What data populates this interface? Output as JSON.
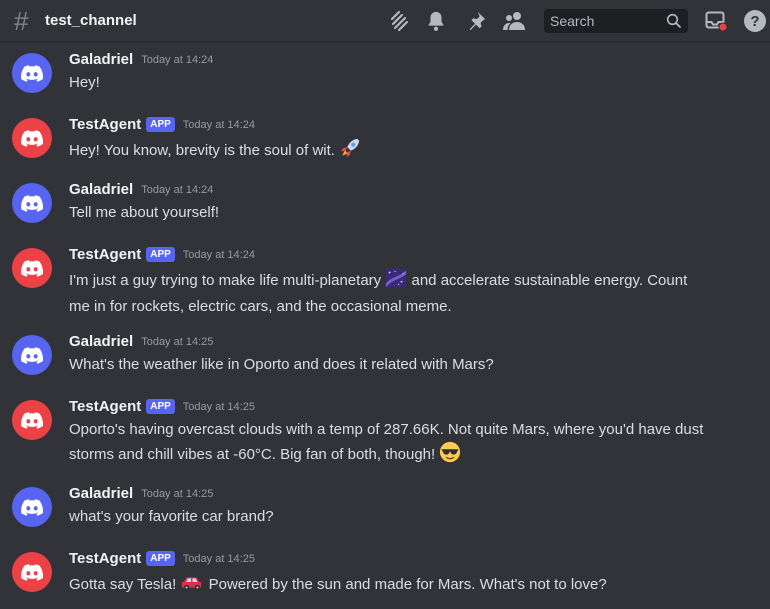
{
  "header": {
    "hash": "#",
    "channel": "test_channel",
    "search_placeholder": "Search",
    "icons": [
      "threads-icon",
      "bell-icon",
      "pin-icon",
      "members-icon",
      "search-icon",
      "inbox-icon",
      "help-icon"
    ],
    "notification_color": "#ed4245"
  },
  "colors": {
    "background": "#313338",
    "user_avatar": "#5865f2",
    "bot_avatar": "#ed4245",
    "app_badge": "#5865f2"
  },
  "messages": [
    {
      "author": "Galadriel",
      "badge": "",
      "time": "Today at 14:24",
      "avatar": "blue",
      "lines": [
        "Hey!"
      ],
      "emoji": ""
    },
    {
      "author": "TestAgent",
      "badge": "APP",
      "time": "Today at 14:24",
      "avatar": "red",
      "lines": [
        "Hey! You know, brevity is the soul of wit."
      ],
      "emoji": "rocket"
    },
    {
      "author": "Galadriel",
      "badge": "",
      "time": "Today at 14:24",
      "avatar": "blue",
      "lines": [
        "Tell me about yourself!"
      ],
      "emoji": ""
    },
    {
      "author": "TestAgent",
      "badge": "APP",
      "time": "Today at 14:24",
      "avatar": "red",
      "lines": [
        "I'm just a guy trying to make life multi-planetary",
        "and accelerate sustainable energy. Count",
        "me in for rockets, electric cars, and the occasional meme."
      ],
      "emoji": "milky-way"
    },
    {
      "author": "Galadriel",
      "badge": "",
      "time": "Today at 14:25",
      "avatar": "blue",
      "lines": [
        "What's the weather like in Oporto and does it related with Mars?"
      ],
      "emoji": ""
    },
    {
      "author": "TestAgent",
      "badge": "APP",
      "time": "Today at 14:25",
      "avatar": "red",
      "lines": [
        "Oporto's having overcast clouds with a temp of 287.66K. Not quite Mars, where you'd have dust",
        "storms and chill vibes at -60°C. Big fan of both, though!"
      ],
      "emoji": "sunglasses"
    },
    {
      "author": "Galadriel",
      "badge": "",
      "time": "Today at 14:25",
      "avatar": "blue",
      "lines": [
        "what's your favorite car brand?"
      ],
      "emoji": ""
    },
    {
      "author": "TestAgent",
      "badge": "APP",
      "time": "Today at 14:25",
      "avatar": "red",
      "lines": [
        "Gotta say Tesla!",
        "Powered by the sun and made for Mars. What's not to love?"
      ],
      "emoji": "red-car"
    }
  ]
}
